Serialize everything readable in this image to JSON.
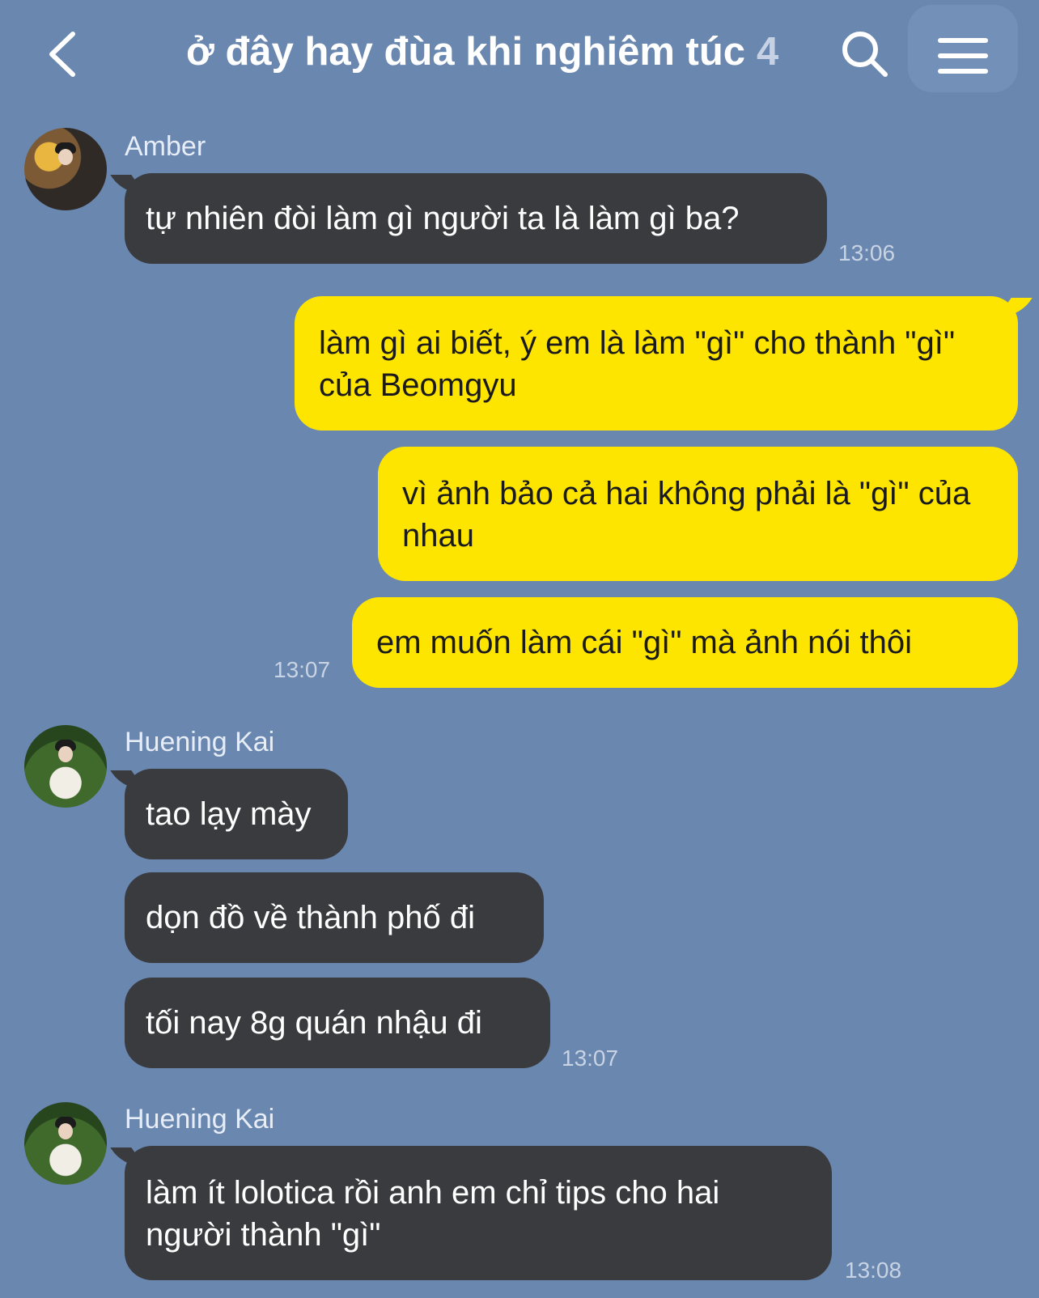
{
  "header": {
    "title": "ở đây hay đùa khi nghiêm túc",
    "member_count": "4"
  },
  "messages": [
    {
      "sender": "Amber",
      "text": "tự nhiên đòi làm gì người ta là làm gì ba?",
      "time": "13:06"
    },
    {
      "sender": "me",
      "text": "làm gì ai biết, ý em là làm \"gì\" cho thành \"gì\" của Beomgyu"
    },
    {
      "sender": "me",
      "text": "vì ảnh bảo cả hai không phải là \"gì\" của nhau"
    },
    {
      "sender": "me",
      "text": "em muốn làm cái \"gì\" mà ảnh nói thôi",
      "time": "13:07"
    },
    {
      "sender": "Huening Kai",
      "text": "tao lạy mày"
    },
    {
      "sender": "Huening Kai",
      "text": "dọn đồ về thành phố đi"
    },
    {
      "sender": "Huening Kai",
      "text": "tối nay 8g quán nhậu đi",
      "time": "13:07"
    },
    {
      "sender": "Huening Kai",
      "text": "làm ít lolotica rồi anh em chỉ tips cho hai người thành \"gì\"",
      "time": "13:08"
    }
  ],
  "icons": {
    "back": "chevron-left-icon",
    "search": "search-icon",
    "menu": "hamburger-menu-icon"
  },
  "colors": {
    "background": "#6a87b0",
    "incoming_bubble": "#3a3b3f",
    "outgoing_bubble": "#fee500",
    "timestamp": "#c8d3e3"
  }
}
